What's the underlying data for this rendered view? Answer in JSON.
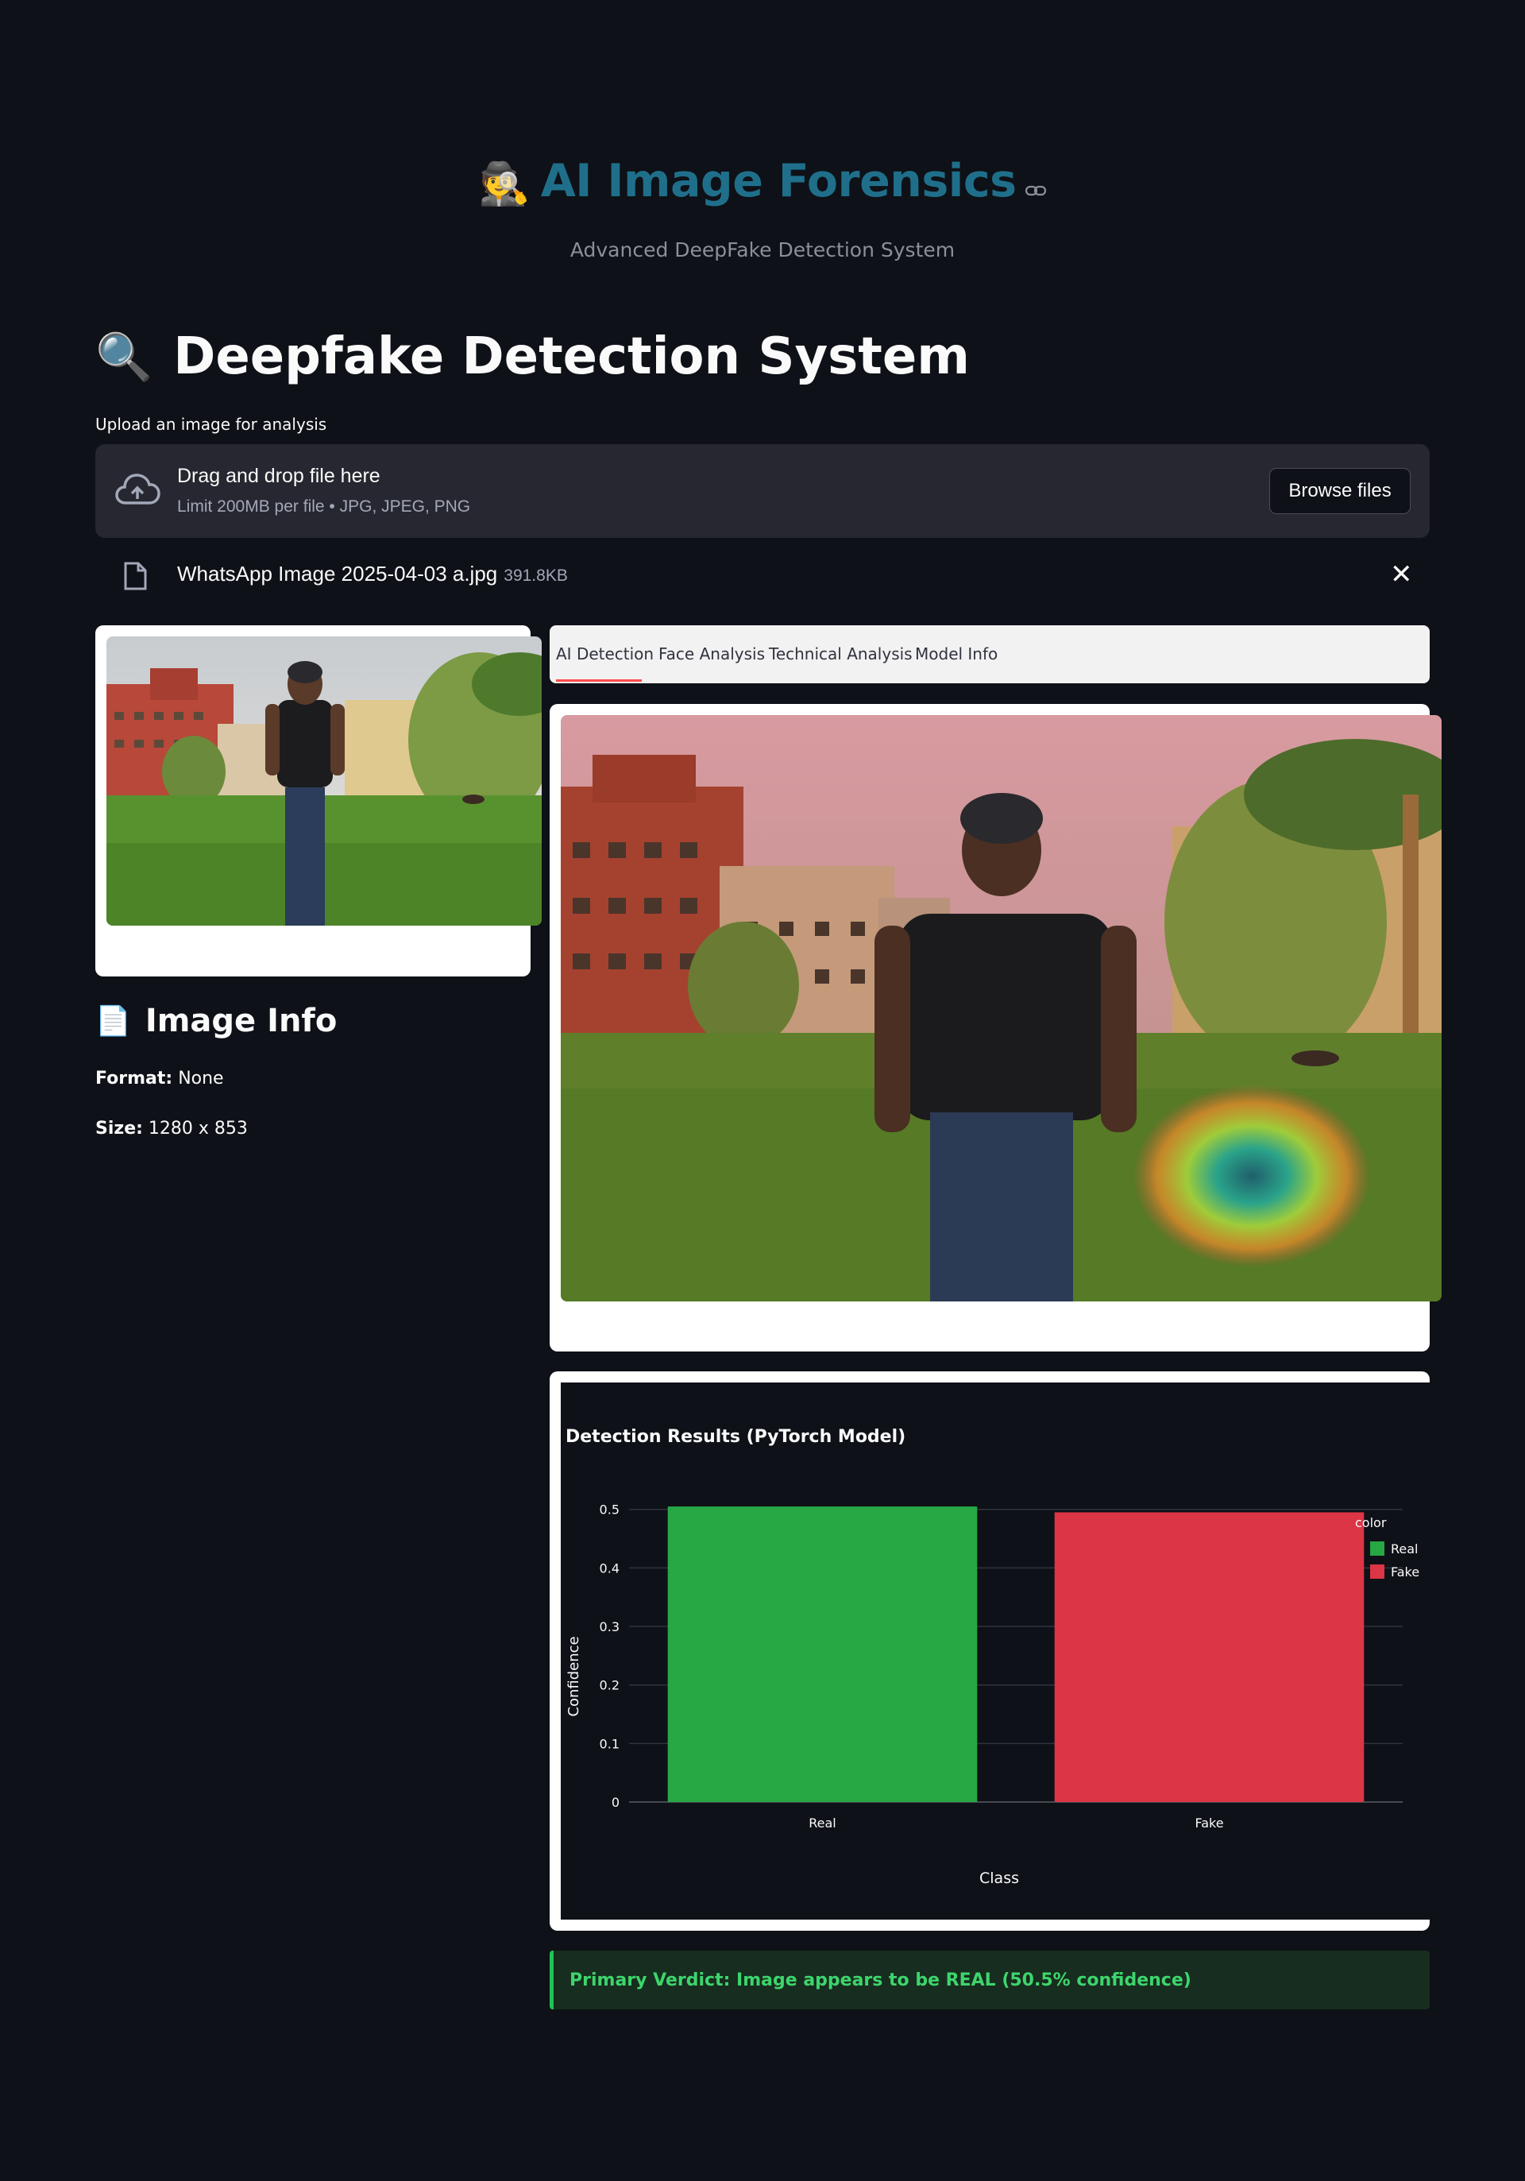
{
  "header": {
    "emoji": "🕵️",
    "title": "AI Image Forensics",
    "subtitle": "Advanced DeepFake Detection System"
  },
  "page": {
    "emoji": "🔍",
    "title": "Deepfake Detection System"
  },
  "uploader": {
    "label": "Upload an image for analysis",
    "drop_title": "Drag and drop file here",
    "drop_sub": "Limit 200MB per file • JPG, JPEG, PNG",
    "browse_label": "Browse files",
    "file_name": "WhatsApp Image 2025-04-03 a.jpg",
    "file_size": "391.8KB",
    "remove_label": "✕"
  },
  "image_info": {
    "emoji": "📄",
    "title": "Image Info",
    "format_label": "Format:",
    "format_value": "None",
    "size_label": "Size:",
    "size_value": "1280 x 853"
  },
  "tabs": [
    {
      "label": "AI Detection",
      "active": true
    },
    {
      "label": "Face Analysis",
      "active": false
    },
    {
      "label": "Technical Analysis",
      "active": false
    },
    {
      "label": "Model Info",
      "active": false
    }
  ],
  "chart_data": {
    "type": "bar",
    "title": "Detection Results (PyTorch Model)",
    "xlabel": "Class",
    "ylabel": "Confidence",
    "categories": [
      "Real",
      "Fake"
    ],
    "values": [
      0.505,
      0.495
    ],
    "colors": [
      "#28a745",
      "#dc3545"
    ],
    "ylim": [
      0,
      0.52
    ],
    "yticks": [
      0,
      0.1,
      0.2,
      0.3,
      0.4,
      0.5
    ],
    "ytick_labels": [
      "0",
      "0.1",
      "0.2",
      "0.3",
      "0.4",
      "0.5"
    ],
    "legend_title": "color",
    "legend": [
      "Real",
      "Fake"
    ],
    "legend_position": "top-right",
    "grid": true
  },
  "verdict": {
    "text": "Primary Verdict: Image appears to be REAL (50.5% confidence)"
  },
  "colors": {
    "background": "#0e1117",
    "title_accent": "#1f6f8b",
    "tab_active": "#ff4b4b",
    "success_text": "#3dd56d",
    "success_bg": "#172d1f",
    "real": "#28a745",
    "fake": "#dc3545"
  },
  "icons": {
    "link": "link-icon",
    "upload": "cloud-upload-icon",
    "file": "file-icon",
    "close": "close-icon"
  }
}
